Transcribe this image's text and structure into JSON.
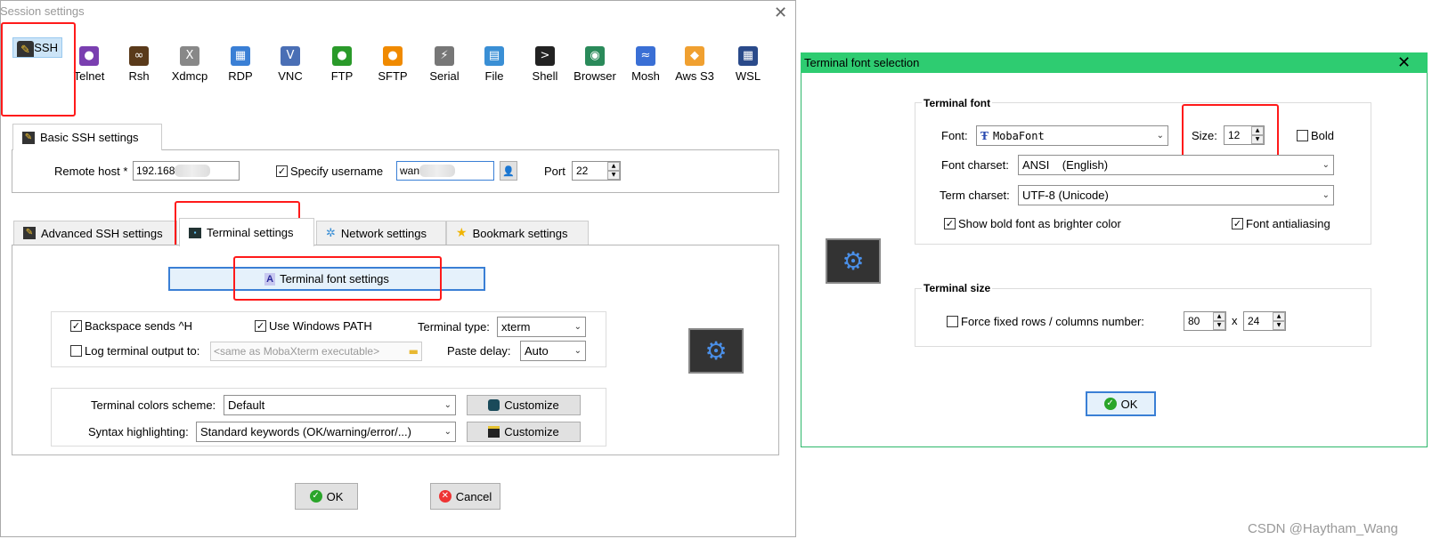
{
  "session_window": {
    "title": "Session settings",
    "session_types": [
      {
        "label": "SSH",
        "icon": "ssh-icon",
        "color": "#333333"
      },
      {
        "label": "Telnet",
        "icon": "telnet-icon",
        "color": "#7a3fb0"
      },
      {
        "label": "Rsh",
        "icon": "rsh-icon",
        "color": "#5a3a1a"
      },
      {
        "label": "Xdmcp",
        "icon": "xdmcp-icon",
        "color": "#888888"
      },
      {
        "label": "RDP",
        "icon": "rdp-icon",
        "color": "#3a7fd5"
      },
      {
        "label": "VNC",
        "icon": "vnc-icon",
        "color": "#4a6fb5"
      },
      {
        "label": "FTP",
        "icon": "ftp-icon",
        "color": "#2a9a2a"
      },
      {
        "label": "SFTP",
        "icon": "sftp-icon",
        "color": "#f08a00"
      },
      {
        "label": "Serial",
        "icon": "serial-icon",
        "color": "#777777"
      },
      {
        "label": "File",
        "icon": "file-icon",
        "color": "#3a8fd5"
      },
      {
        "label": "Shell",
        "icon": "shell-icon",
        "color": "#222222"
      },
      {
        "label": "Browser",
        "icon": "browser-icon",
        "color": "#2a8a5a"
      },
      {
        "label": "Mosh",
        "icon": "mosh-icon",
        "color": "#3a6fd5"
      },
      {
        "label": "Aws S3",
        "icon": "aws-s3-icon",
        "color": "#f0a030"
      },
      {
        "label": "WSL",
        "icon": "wsl-icon",
        "color": "#2a4a8a"
      }
    ],
    "basic_tab": "Basic SSH settings",
    "remote_host_label": "Remote host *",
    "remote_host_value": "192.168",
    "specify_username_label": "Specify username",
    "username_value": "wan",
    "port_label": "Port",
    "port_value": "22",
    "tabs": [
      "Advanced SSH settings",
      "Terminal settings",
      "Network settings",
      "Bookmark settings"
    ],
    "font_settings_button": "Terminal font settings",
    "backspace_label": "Backspace sends ^H",
    "use_windows_path_label": "Use Windows PATH",
    "terminal_type_label": "Terminal type:",
    "terminal_type_value": "xterm",
    "log_output_label": "Log terminal output to:",
    "log_output_placeholder": "<same as MobaXterm executable>",
    "paste_delay_label": "Paste delay:",
    "paste_delay_value": "Auto",
    "colors_scheme_label": "Terminal colors scheme:",
    "colors_scheme_value": "Default",
    "syntax_label": "Syntax highlighting:",
    "syntax_value": "Standard keywords (OK/warning/error/...)",
    "customize_label": "Customize",
    "ok_label": "OK",
    "cancel_label": "Cancel"
  },
  "font_window": {
    "title": "Terminal font selection",
    "terminal_font_group": "Terminal font",
    "font_label": "Font:",
    "font_value": "MobaFont",
    "size_label": "Size:",
    "size_value": "12",
    "bold_label": "Bold",
    "charset_label": "Font charset:",
    "charset_value": "ANSI    (English)",
    "term_charset_label": "Term charset:",
    "term_charset_value": "UTF-8 (Unicode)",
    "bold_brighter_label": "Show bold font as brighter color",
    "antialias_label": "Font antialiasing",
    "terminal_size_group": "Terminal size",
    "force_fixed_label": "Force fixed rows / columns number:",
    "rows_value": "80",
    "x_label": "x",
    "cols_value": "24",
    "ok_label": "OK"
  },
  "watermark": "CSDN @Haytham_Wang",
  "colors": {
    "accent_red": "#ff1a1a",
    "title_green": "#2ecc71",
    "selected_blue": "#cce4f7"
  }
}
